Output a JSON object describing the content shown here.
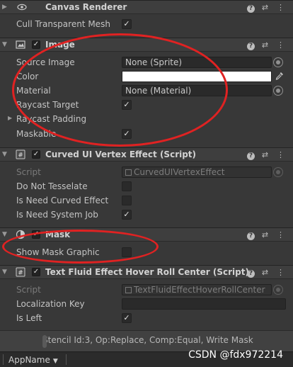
{
  "canvas_renderer": {
    "title": "Canvas Renderer",
    "rows": [
      {
        "label": "Cull Transparent Mesh",
        "checked": true
      }
    ]
  },
  "image": {
    "title": "Image",
    "source_image": {
      "label": "Source Image",
      "value": "None (Sprite)"
    },
    "color": {
      "label": "Color",
      "value": "#ffffff"
    },
    "material": {
      "label": "Material",
      "value": "None (Material)"
    },
    "raycast_target": {
      "label": "Raycast Target",
      "checked": true
    },
    "raycast_padding": {
      "label": "Raycast Padding"
    },
    "maskable": {
      "label": "Maskable",
      "checked": true
    }
  },
  "curved": {
    "title": "Curved UI Vertex Effect (Script)",
    "script": {
      "label": "Script",
      "value": "CurvedUIVertexEffect"
    },
    "do_not_tesselate": {
      "label": "Do Not Tesselate",
      "checked": false
    },
    "is_need_curved_effect": {
      "label": "Is Need Curved Effect",
      "checked": false
    },
    "is_need_system_job": {
      "label": "Is Need System Job",
      "checked": true
    }
  },
  "mask": {
    "title": "Mask",
    "show_mask_graphic": {
      "label": "Show Mask Graphic",
      "checked": false
    }
  },
  "text_fluid": {
    "title": "Text Fluid Effect Hover Roll Center (Script)",
    "script": {
      "label": "Script",
      "value": "TextFluidEffectHoverRollCenter"
    },
    "localization_key": {
      "label": "Localization Key",
      "value": ""
    },
    "is_left": {
      "label": "Is Left",
      "checked": true
    }
  },
  "stencil_info": "Stencil Id:3, Op:Replace, Comp:Equal, Write Mask",
  "bottom_bar": {
    "app_name": "AppName"
  },
  "watermark": "CSDN @fdx972214",
  "icons": {
    "help": "help-icon",
    "presets": "presets-icon",
    "menu": "kebab-menu-icon",
    "eye": "eye-icon",
    "image": "image-icon",
    "script": "csharp-script-icon",
    "mask": "mask-icon"
  },
  "colors": {
    "annotation": "#e02222",
    "accent": "#c4c4c4"
  }
}
